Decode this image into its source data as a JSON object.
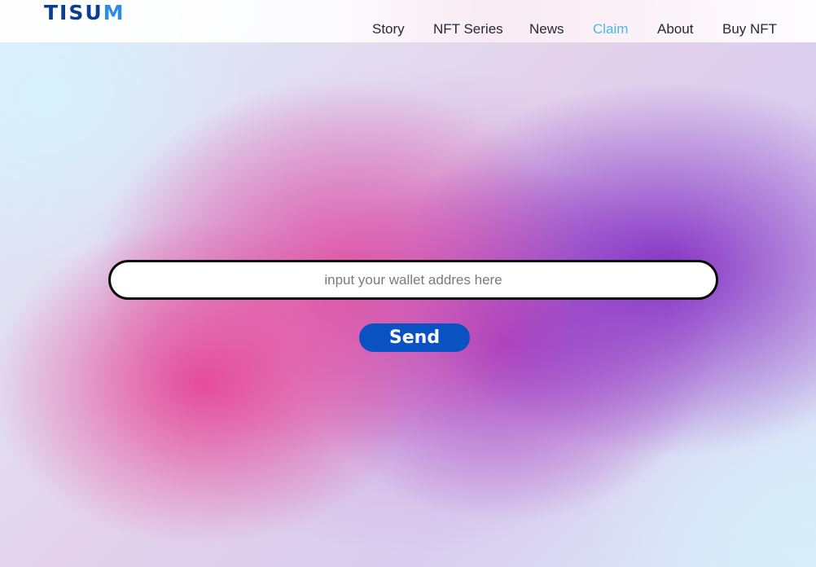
{
  "brand": {
    "logo_text_dark": "TISU",
    "logo_text_light": "M",
    "colors": {
      "dark": "#0b3d91",
      "light": "#2d8de6"
    }
  },
  "nav": {
    "items": [
      {
        "label": "Story",
        "active": false
      },
      {
        "label": "NFT Series",
        "active": false
      },
      {
        "label": "News",
        "active": false
      },
      {
        "label": "Claim",
        "active": true
      },
      {
        "label": "About",
        "active": false
      },
      {
        "label": "Buy NFT",
        "active": false
      }
    ],
    "active_color": "#4cb8e0"
  },
  "claim_form": {
    "wallet_placeholder": "input your wallet addres here",
    "wallet_value": "",
    "send_label": "Send",
    "send_color": "#0a52c2"
  }
}
